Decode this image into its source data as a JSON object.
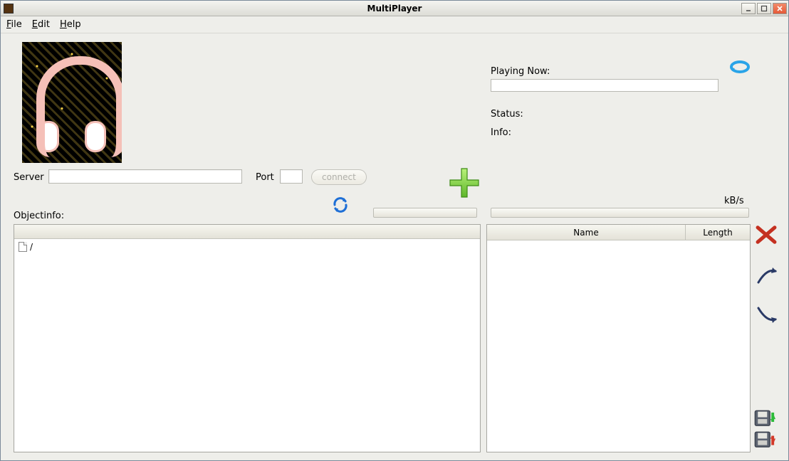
{
  "window": {
    "title": "MultiPlayer"
  },
  "menubar": {
    "file": "File",
    "edit": "Edit",
    "help": "Help"
  },
  "connection": {
    "server_label": "Server",
    "server_value": "",
    "port_label": "Port",
    "port_value": "",
    "connect_label": "connect"
  },
  "left": {
    "objectinfo_label": "Objectinfo:",
    "tree_root_label": "/"
  },
  "right": {
    "playing_now_label": "Playing Now:",
    "playing_now_value": "",
    "status_label": "Status:",
    "status_value": "",
    "info_label": "Info:",
    "info_value": "",
    "speed_unit": "kB/s",
    "table": {
      "col_name": "Name",
      "col_length": "Length",
      "rows": []
    }
  },
  "icons": {
    "app": "app-icon",
    "minimize": "minimize-icon",
    "maximize": "maximize-icon",
    "close": "close-icon",
    "refresh": "refresh-icon",
    "add": "plus-icon",
    "loop": "loop-icon",
    "delete": "delete-icon",
    "arrow_up": "arrow-up-icon",
    "arrow_down": "arrow-down-icon",
    "save_down": "save-down-icon",
    "save_up": "save-up-icon"
  }
}
